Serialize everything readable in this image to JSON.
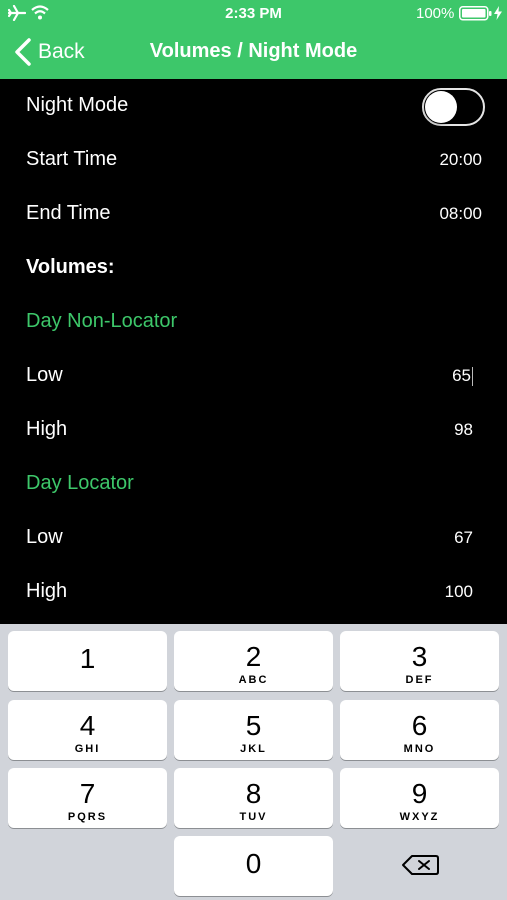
{
  "status_bar": {
    "time": "2:33 PM",
    "battery_percent": "100%",
    "icons": [
      "airplane-icon",
      "wifi-icon",
      "battery-icon",
      "charging-bolt-icon"
    ]
  },
  "nav": {
    "back_label": "Back",
    "title": "Volumes / Night Mode"
  },
  "colors": {
    "accent": "#3dc76a",
    "background": "#000000",
    "keypad_bg": "#d1d4da"
  },
  "settings": {
    "night_mode": {
      "label": "Night Mode",
      "enabled": false
    },
    "start_time": {
      "label": "Start Time",
      "value": "20:00"
    },
    "end_time": {
      "label": "End Time",
      "value": "08:00"
    },
    "volumes_header": "Volumes:",
    "groups": [
      {
        "title": "Day Non-Locator",
        "low": {
          "label": "Low",
          "value": "65"
        },
        "high": {
          "label": "High",
          "value": "98"
        }
      },
      {
        "title": "Day Locator",
        "low": {
          "label": "Low",
          "value": "67"
        },
        "high": {
          "label": "High",
          "value": "100"
        }
      }
    ]
  },
  "keypad": {
    "keys": [
      {
        "num": "1",
        "letters": ""
      },
      {
        "num": "2",
        "letters": "ABC"
      },
      {
        "num": "3",
        "letters": "DEF"
      },
      {
        "num": "4",
        "letters": "GHI"
      },
      {
        "num": "5",
        "letters": "JKL"
      },
      {
        "num": "6",
        "letters": "MNO"
      },
      {
        "num": "7",
        "letters": "PQRS"
      },
      {
        "num": "8",
        "letters": "TUV"
      },
      {
        "num": "9",
        "letters": "WXYZ"
      },
      {
        "num": "0",
        "letters": ""
      }
    ],
    "delete_icon": "backspace-icon"
  }
}
